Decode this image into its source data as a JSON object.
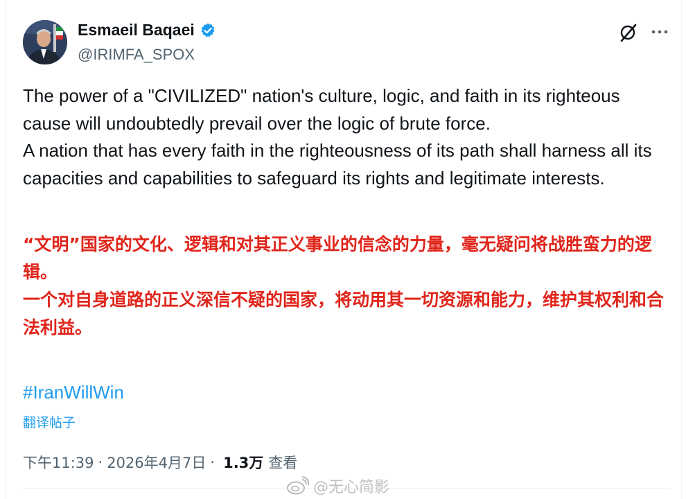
{
  "author": {
    "name": "Esmaeil Baqaei",
    "handle": "@IRIMFA_SPOX",
    "verified": true,
    "accent_color": "#1d9bf0"
  },
  "icons": {
    "grok": "grok-icon",
    "more": "more-icon",
    "verified": "verified-badge-icon"
  },
  "post": {
    "english": [
      "The power of a \"CIVILIZED\" nation's culture, logic, and faith in its righteous cause will undoubtedly prevail over the logic of brute force.",
      "A nation that has every faith in the righteousness of its path shall harness all its capacities and capabilities to safeguard its rights and legitimate interests."
    ],
    "chinese": [
      "“文明”国家的文化、逻辑和对其正义事业的信念的力量，毫无疑问将战胜蛮力的逻辑。",
      "一个对自身道路的正义深信不疑的国家，将动用其一切资源和能力，维护其权利和合法利益。"
    ],
    "chinese_color": "#e0251b",
    "hashtag": "#IranWillWin",
    "translate_label": "翻译帖子"
  },
  "meta": {
    "time": "下午11:39",
    "date": "2026年4月7日",
    "separator": "·",
    "views_count": "1.3万",
    "views_label": "查看"
  },
  "watermark": {
    "text": "@无心简影"
  }
}
